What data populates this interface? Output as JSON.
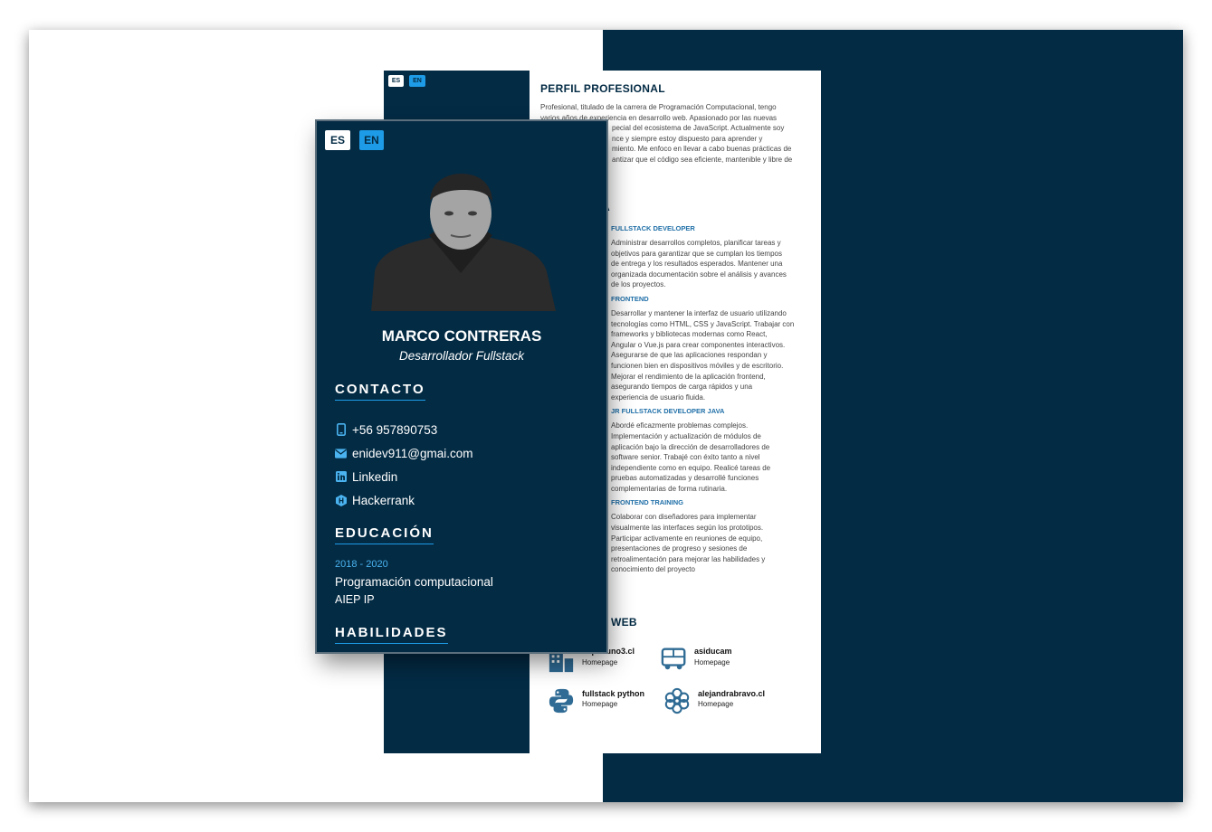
{
  "desktop": {
    "lang": {
      "es": "ES",
      "en": "EN"
    },
    "profile": {
      "title": "PERFIL PROFESIONAL",
      "lines": [
        "Profesional, titulado de la carrera de Programación Computacional, tengo",
        "varios años de experiencia en desarrollo web. Apasionado por las nuevas",
        "pecial del ecosistema de JavaScript. Actualmente soy",
        "nce y siempre estoy dispuesto para aprender y",
        "miento. Me enfoco en llevar a cabo buenas prácticas de",
        "antizar que el código sea eficiente, mantenible y libre de"
      ]
    },
    "experience": {
      "title_fragment": "A",
      "jobs": [
        {
          "title": "FULLSTACK DEVELOPER",
          "lines": [
            "Administrar desarrollos completos, planificar tareas y",
            "objetivos para garantizar que se cumplan los tiempos",
            "de entrega y los resultados esperados. Mantener una",
            "organizada documentación sobre el análisis y avances",
            "de los proyectos."
          ]
        },
        {
          "title": "FRONTEND",
          "lines": [
            "Desarrollar y mantener la interfaz de usuario utilizando",
            "tecnologías como HTML, CSS y JavaScript. Trabajar con",
            "frameworks y bibliotecas modernas como React,",
            "Angular o Vue.js para crear componentes interactivos.",
            "Asegurarse de que las aplicaciones respondan y",
            "funcionen bien en dispositivos móviles y de escritorio.",
            "Mejorar el rendimiento de la aplicación frontend,",
            "asegurando tiempos de carga rápidos y una",
            "experiencia de usuario fluida."
          ]
        },
        {
          "title": "JR FULLSTACK DEVELOPER JAVA",
          "lines": [
            "Abordé eficazmente problemas complejos.",
            "Implementación y actualización de módulos de",
            "aplicación bajo la dirección de desarrolladores de",
            "software senior. Trabajé con éxito tanto a nivel",
            "independiente como en equipo. Realicé tareas de",
            "pruebas automatizadas y desarrollé funciones",
            "complementarias de forma rutinaria."
          ]
        },
        {
          "title": "FRONTEND TRAINING",
          "lines": [
            "Colaborar con diseñadores para implementar",
            "visualmente las interfaces según los prototipos.",
            "Participar activamente en reuniones de equipo,",
            "presentaciones de progreso y sesiones de",
            "retroalimentación para mejorar las habilidades y",
            "conocimiento del proyecto"
          ]
        }
      ]
    },
    "web": {
      "title_fragment": "WEB",
      "projects": [
        {
          "name": "cuposuno3.cl",
          "sub": "Homepage",
          "icon": "building-icon"
        },
        {
          "name": "asiducam",
          "sub": "Homepage",
          "icon": "bus-icon"
        },
        {
          "name": "fullstack python",
          "sub": "Homepage",
          "icon": "python-icon"
        },
        {
          "name": "alejandrabravo.cl",
          "sub": "Homepage",
          "icon": "flower-icon"
        }
      ]
    }
  },
  "mobile": {
    "lang": {
      "es": "ES",
      "en": "EN"
    },
    "name": "MARCO CONTRERAS",
    "role": "Desarrollador Fullstack",
    "contact": {
      "title": "CONTACTO",
      "phone": "+56 957890753",
      "email": "enidev911@gmai.com",
      "linkedin": "Linkedin",
      "hackerrank": "Hackerrank"
    },
    "education": {
      "title": "EDUCACIÓN",
      "years": "2018 - 2020",
      "degree": "Programación computacional",
      "school": "AIEP IP"
    },
    "skills": {
      "title": "HABILIDADES"
    }
  },
  "colors": {
    "navy": "#032b44",
    "accent": "#1e9be6",
    "job_title": "#1f6fa8"
  }
}
